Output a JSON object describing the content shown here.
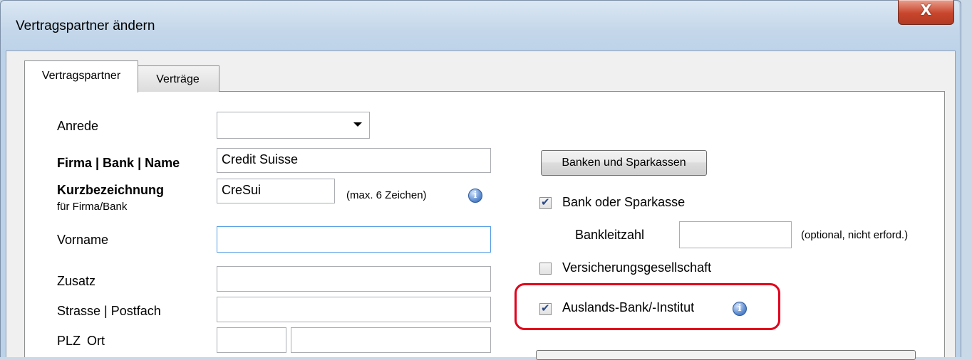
{
  "window": {
    "title": "Vertragspartner ändern",
    "close_symbol": "X"
  },
  "tabs": [
    {
      "label": "Vertragspartner",
      "active": true
    },
    {
      "label": "Verträge",
      "active": false
    }
  ],
  "form": {
    "anrede_label": "Anrede",
    "anrede_value": "",
    "firma_label": "Firma | Bank | Name",
    "firma_value": "Credit Suisse",
    "kurz_label": "Kurzbezeichnung",
    "kurz_sublabel": "für Firma/Bank",
    "kurz_value": "CreSui",
    "kurz_hint": "(max. 6 Zeichen)",
    "vorname_label": "Vorname",
    "vorname_value": "",
    "zusatz_label": "Zusatz",
    "zusatz_value": "",
    "strasse_label": "Strasse | Postfach",
    "strasse_value": "",
    "plz_label": "PLZ",
    "ort_label": "Ort",
    "plz_value": "",
    "ort_value": ""
  },
  "right": {
    "banken_button": "Banken und Sparkassen",
    "bank_checkbox_label": "Bank oder Sparkasse",
    "bank_checked": true,
    "blz_label": "Bankleitzahl",
    "blz_value": "",
    "blz_hint": "(optional, nicht erford.)",
    "versicherung_label": "Versicherungsgesellschaft",
    "versicherung_checked": false,
    "ausland_label": "Auslands-Bank/-Institut",
    "ausland_checked": true
  },
  "colors": {
    "highlight": "#e3001b",
    "close_button": "#c8452c",
    "checkmark": "#2e4a86"
  },
  "icons": [
    "close-icon",
    "dropdown-arrow-icon",
    "info-icon",
    "checkbox"
  ]
}
